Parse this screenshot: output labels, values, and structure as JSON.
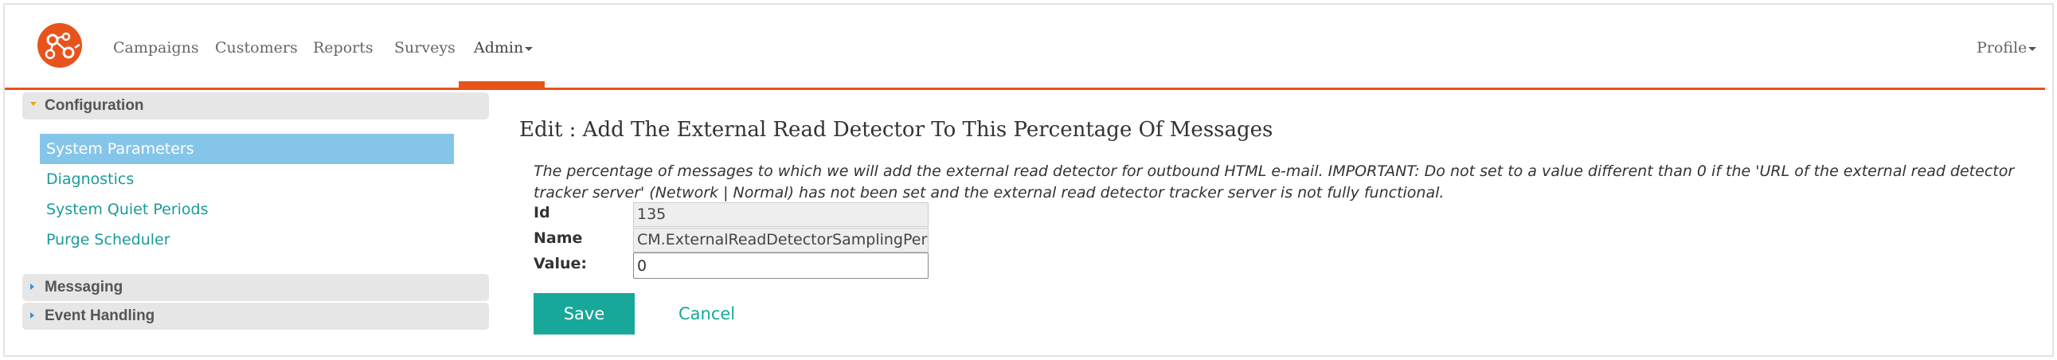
{
  "nav": {
    "items": [
      {
        "label": "Campaigns"
      },
      {
        "label": "Customers"
      },
      {
        "label": "Reports"
      },
      {
        "label": "Surveys"
      },
      {
        "label": "Admin"
      }
    ],
    "active": "Admin",
    "profile_label": "Profile"
  },
  "colors": {
    "accent": "#e8531c",
    "teal": "#17a89a",
    "selected_bg": "#86c5ea",
    "panel_bg": "#e6e6e6"
  },
  "sidebar": {
    "configuration": {
      "label": "Configuration",
      "items": [
        {
          "label": "System Parameters",
          "selected": true
        },
        {
          "label": "Diagnostics"
        },
        {
          "label": "System Quiet Periods"
        },
        {
          "label": "Purge Scheduler"
        }
      ]
    },
    "messaging": {
      "label": "Messaging"
    },
    "event_handling": {
      "label": "Event Handling"
    }
  },
  "form": {
    "title": "Edit : Add The External Read Detector To This Percentage Of Messages",
    "description": "The percentage of messages to which we will add the external read detector for outbound HTML e-mail. IMPORTANT: Do not set to a value different than 0 if the 'URL of the external read detector tracker server' (Network | Normal) has not been set and the external read detector tracker server is not fully functional.",
    "id_label": "Id",
    "id_value": "135",
    "name_label": "Name",
    "name_value": "CM.ExternalReadDetectorSamplingPercentage",
    "value_label": "Value:",
    "value_value": "0",
    "save_label": "Save",
    "cancel_label": "Cancel"
  }
}
